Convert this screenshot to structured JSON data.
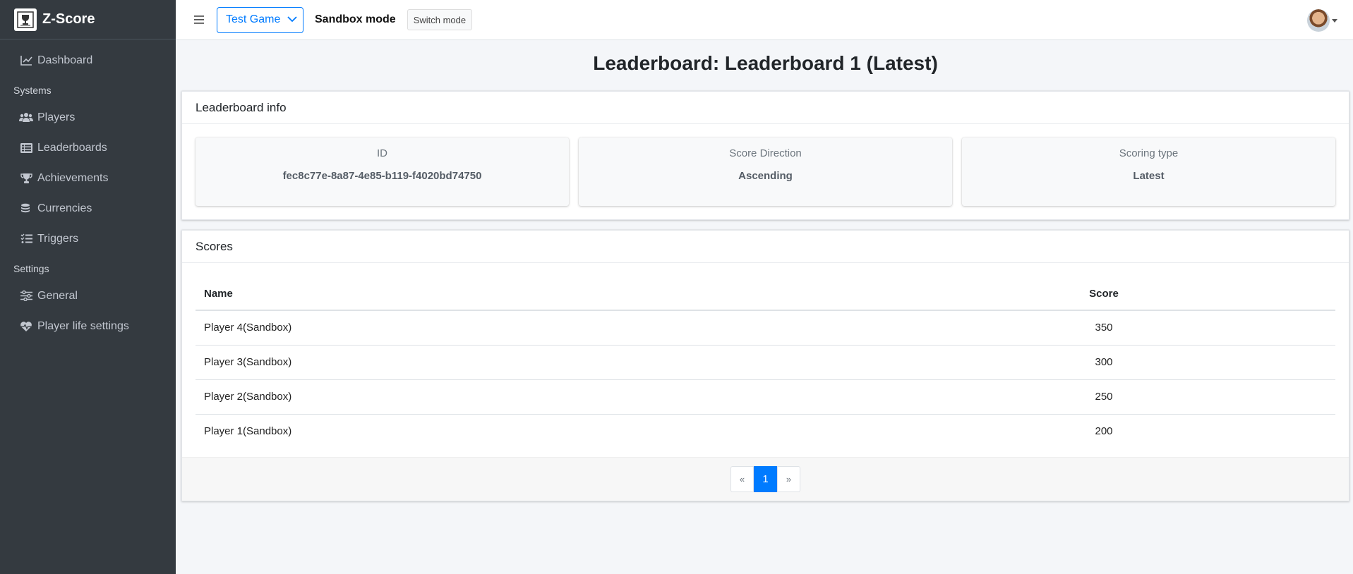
{
  "brand": {
    "name": "Z-Score"
  },
  "sidebar": {
    "items": [
      {
        "label": "Dashboard",
        "icon": "chart-line-icon"
      },
      {
        "header": "Systems"
      },
      {
        "label": "Players",
        "icon": "users-icon"
      },
      {
        "label": "Leaderboards",
        "icon": "list-icon"
      },
      {
        "label": "Achievements",
        "icon": "trophy-icon"
      },
      {
        "label": "Currencies",
        "icon": "coins-icon"
      },
      {
        "label": "Triggers",
        "icon": "tasks-icon"
      },
      {
        "header": "Settings"
      },
      {
        "label": "General",
        "icon": "sliders-icon"
      },
      {
        "label": "Player life settings",
        "icon": "heartbeat-icon"
      }
    ]
  },
  "topbar": {
    "game_select": "Test Game",
    "mode_label": "Sandbox mode",
    "switch_label": "Switch mode"
  },
  "page": {
    "title": "Leaderboard: Leaderboard 1 (Latest)"
  },
  "info": {
    "header": "Leaderboard info",
    "id_label": "ID",
    "id_value": "fec8c77e-8a87-4e85-b119-f4020bd74750",
    "direction_label": "Score Direction",
    "direction_value": "Ascending",
    "type_label": "Scoring type",
    "type_value": "Latest"
  },
  "scores": {
    "header": "Scores",
    "columns": {
      "name": "Name",
      "score": "Score"
    },
    "rows": [
      {
        "name": "Player 4(Sandbox)",
        "score": "350"
      },
      {
        "name": "Player 3(Sandbox)",
        "score": "300"
      },
      {
        "name": "Player 2(Sandbox)",
        "score": "250"
      },
      {
        "name": "Player 1(Sandbox)",
        "score": "200"
      }
    ]
  },
  "pagination": {
    "prev": "«",
    "current": "1",
    "next": "»"
  },
  "colors": {
    "sidebar_bg": "#343a40",
    "accent": "#007bff",
    "page_bg": "#f4f6f9"
  }
}
